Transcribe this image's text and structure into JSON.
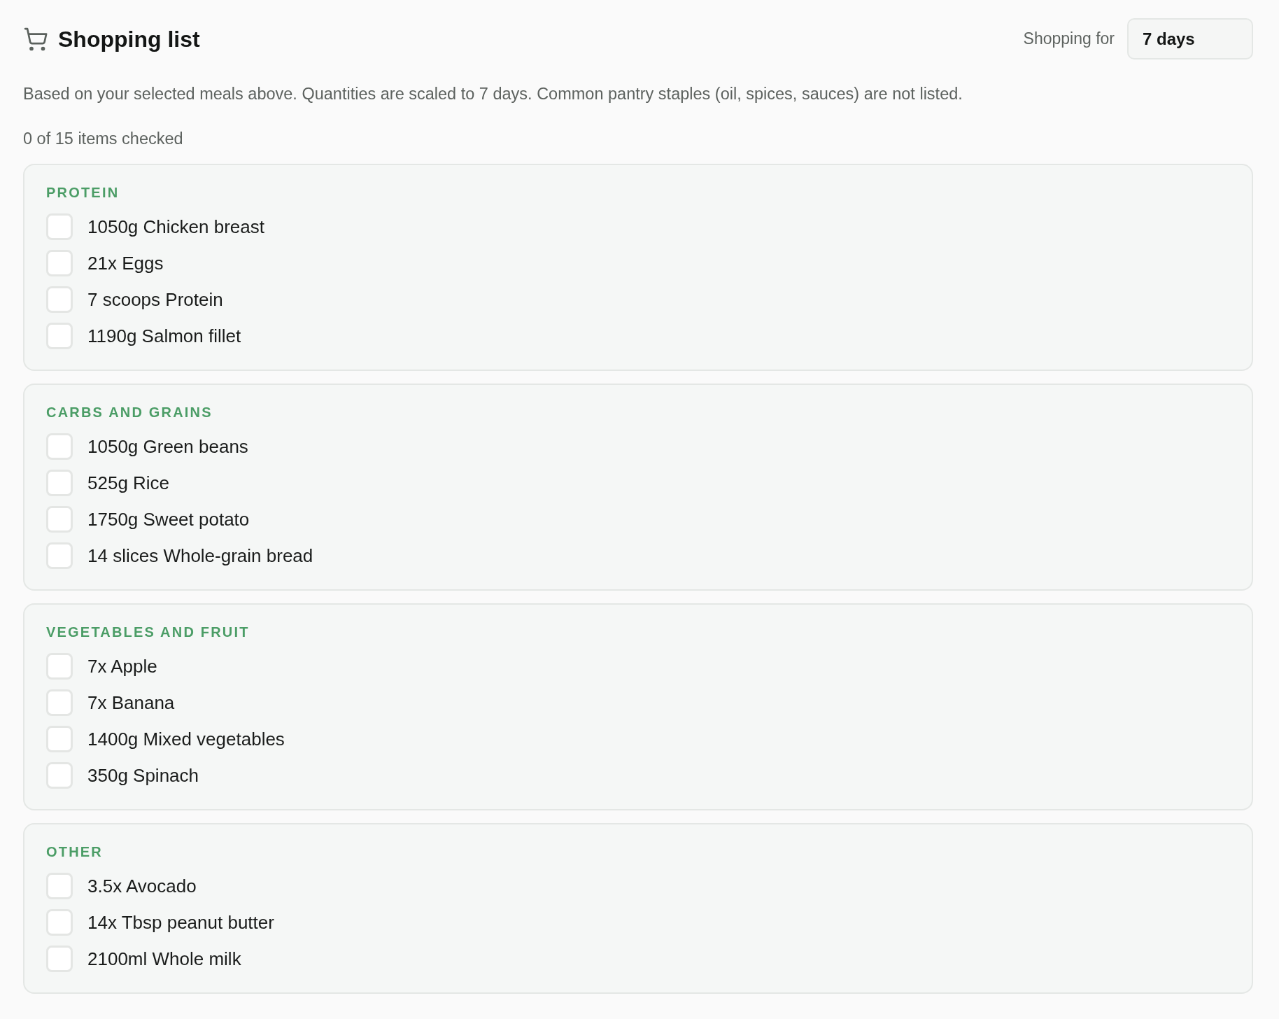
{
  "header": {
    "title": "Shopping list",
    "duration_label": "Shopping for",
    "duration_select": {
      "value": "7 days"
    }
  },
  "description": "Based on your selected meals above. Quantities are scaled to 7 days. Common pantry staples (oil, spices, sauces) are not listed.",
  "progress": "0 of 15 items checked",
  "categories": [
    {
      "name": "PROTEIN",
      "items": [
        {
          "label": "1050g Chicken breast",
          "checked": false
        },
        {
          "label": "21x Eggs",
          "checked": false
        },
        {
          "label": "7 scoops Protein",
          "checked": false
        },
        {
          "label": "1190g Salmon fillet",
          "checked": false
        }
      ]
    },
    {
      "name": "CARBS AND GRAINS",
      "items": [
        {
          "label": "1050g Green beans",
          "checked": false
        },
        {
          "label": "525g Rice",
          "checked": false
        },
        {
          "label": "1750g Sweet potato",
          "checked": false
        },
        {
          "label": "14 slices Whole-grain bread",
          "checked": false
        }
      ]
    },
    {
      "name": "VEGETABLES AND FRUIT",
      "items": [
        {
          "label": "7x Apple",
          "checked": false
        },
        {
          "label": "7x Banana",
          "checked": false
        },
        {
          "label": "1400g Mixed vegetables",
          "checked": false
        },
        {
          "label": "350g Spinach",
          "checked": false
        }
      ]
    },
    {
      "name": "OTHER",
      "items": [
        {
          "label": "3.5x Avocado",
          "checked": false
        },
        {
          "label": "14x Tbsp peanut butter",
          "checked": false
        },
        {
          "label": "2100ml Whole milk",
          "checked": false
        }
      ]
    }
  ]
}
